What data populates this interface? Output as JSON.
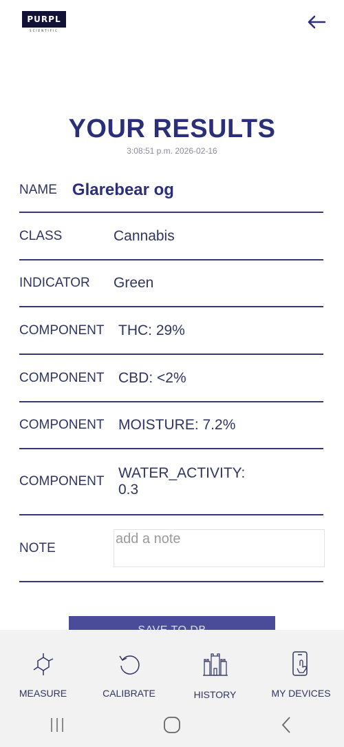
{
  "header": {
    "logo_text": "PURPL",
    "logo_sub": "SCIENTIFIC",
    "back_icon": "arrow-left-icon"
  },
  "results": {
    "title": "YOUR RESULTS",
    "timestamp": "3:08:51 p.m. 2026-02-16",
    "name_label": "NAME",
    "name_value": "Glarebear og",
    "class_label": "CLASS",
    "class_value": "Cannabis",
    "indicator_label": "INDICATOR",
    "indicator_value": "Green",
    "components": [
      {
        "label": "COMPONENT",
        "value": "THC: 29%"
      },
      {
        "label": "COMPONENT",
        "value": "CBD: <2%"
      },
      {
        "label": "COMPONENT",
        "value": "MOISTURE: 7.2%"
      },
      {
        "label": "COMPONENT",
        "value": "WATER_ACTIVITY:\n0.3"
      }
    ],
    "note_label": "NOTE",
    "note_placeholder": "add a note",
    "save_label": "SAVE TO DB"
  },
  "bottom_nav": [
    {
      "label": "MEASURE",
      "icon": "molecule-icon"
    },
    {
      "label": "CALIBRATE",
      "icon": "refresh-icon"
    },
    {
      "label": "HISTORY",
      "icon": "castle-icon"
    },
    {
      "label": "MY DEVICES",
      "icon": "phone-touch-icon"
    }
  ],
  "system_nav": {
    "recents": "recents-icon",
    "home": "home-icon",
    "back": "back-chevron-icon"
  },
  "colors": {
    "primary": "#2b2f7a",
    "button": "#4a4c9a",
    "nav_bg": "#f2f2f2"
  }
}
